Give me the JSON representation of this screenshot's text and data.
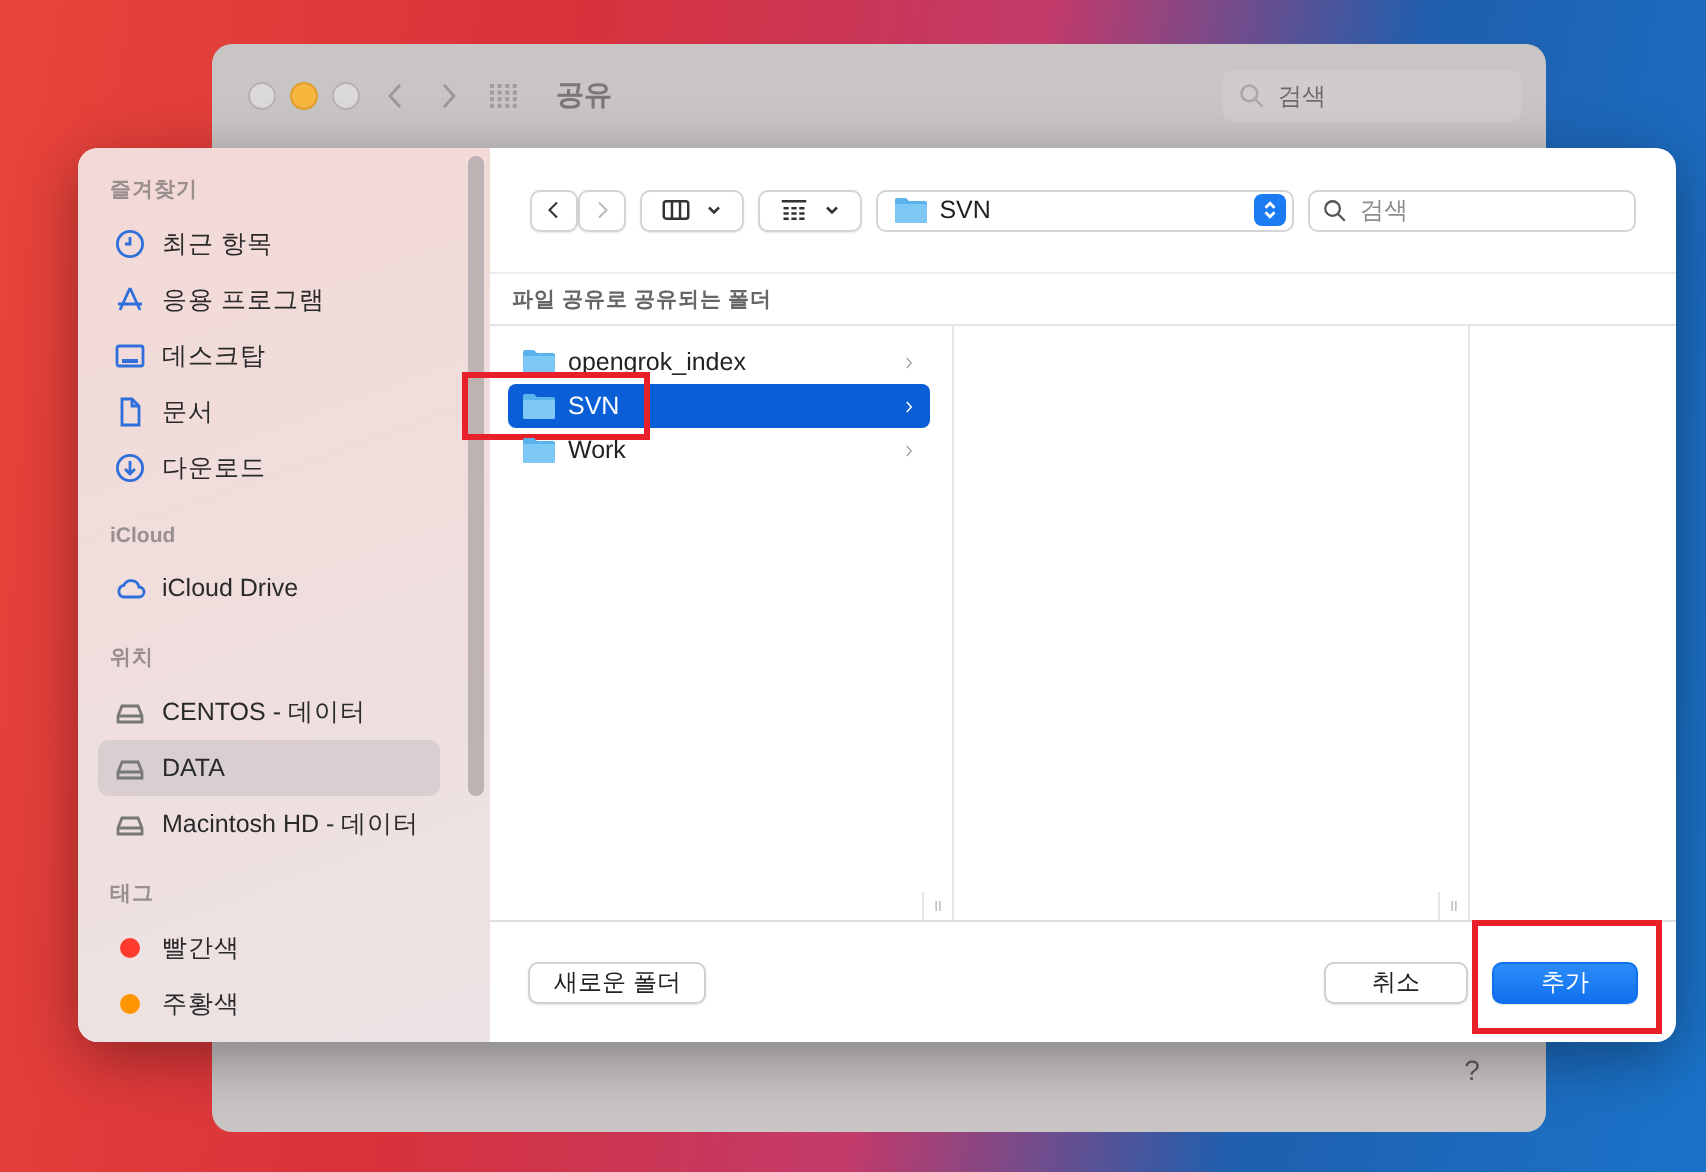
{
  "back_window": {
    "title": "공유",
    "search": {
      "placeholder": "검색"
    },
    "help": "?"
  },
  "sidebar": {
    "sections": [
      {
        "heading": "즐겨찾기",
        "items": [
          {
            "label": "최근 항목",
            "selected": false
          },
          {
            "label": "응용 프로그램",
            "selected": false
          },
          {
            "label": "데스크탑",
            "selected": false
          },
          {
            "label": "문서",
            "selected": false
          },
          {
            "label": "다운로드",
            "selected": false
          }
        ]
      },
      {
        "heading": "iCloud",
        "items": [
          {
            "label": "iCloud Drive",
            "selected": false
          }
        ]
      },
      {
        "heading": "위치",
        "items": [
          {
            "label": "CENTOS - 데이터",
            "selected": false
          },
          {
            "label": "DATA",
            "selected": true
          },
          {
            "label": "Macintosh HD - 데이터",
            "selected": false
          }
        ]
      },
      {
        "heading": "태그",
        "items": [
          {
            "label": "빨간색",
            "color": "#ff3b30",
            "selected": false
          },
          {
            "label": "주황색",
            "color": "#ff9500",
            "selected": false
          }
        ]
      }
    ]
  },
  "toolbar": {
    "location": "SVN",
    "search": {
      "placeholder": "검색"
    }
  },
  "path_header": "파일 공유로 공유되는 폴더",
  "folders": [
    {
      "name": "opengrok_index",
      "selected": false,
      "highlighted": false
    },
    {
      "name": "SVN",
      "selected": true,
      "highlighted": true
    },
    {
      "name": "Work",
      "selected": false,
      "highlighted": false
    }
  ],
  "buttons": [
    {
      "label": "새로운 폴더",
      "kind": "secondary",
      "highlighted": false
    },
    {
      "label": "취소",
      "kind": "secondary",
      "highlighted": false
    },
    {
      "label": "추가",
      "kind": "primary",
      "highlighted": true
    }
  ]
}
